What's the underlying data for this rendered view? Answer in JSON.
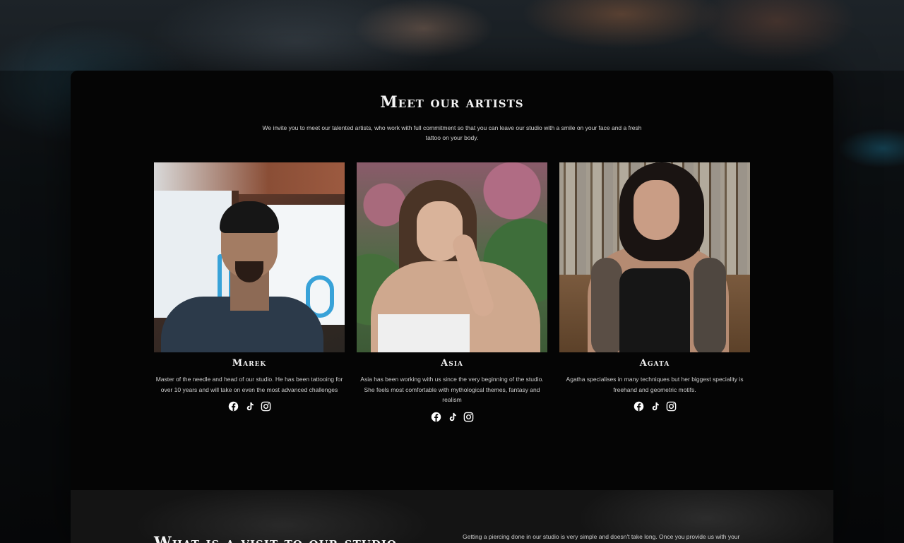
{
  "section": {
    "title": "Meet our artists",
    "intro": "We invite you to meet our talented artists, who work with full commitment so that you can leave our studio with a smile on your face and a fresh tattoo on your body."
  },
  "artists": [
    {
      "name": "Marek",
      "bio": "Master of the needle and head of our studio. He has been tattooing for over 10 years and will take on even the most advanced challenges",
      "socials": [
        "facebook-icon",
        "tiktok-icon",
        "instagram-icon"
      ]
    },
    {
      "name": "Asia",
      "bio": "Asia has been working with us since the very beginning of the studio. She feels most comfortable with mythological themes, fantasy and realism",
      "socials": [
        "facebook-icon",
        "tiktok-icon",
        "instagram-icon"
      ]
    },
    {
      "name": "Agata",
      "bio": "Agatha specialises in many techniques but her biggest speciality is freehand and geometric motifs.",
      "socials": [
        "facebook-icon",
        "tiktok-icon",
        "instagram-icon"
      ]
    }
  ],
  "visit_section": {
    "title": "What is a visit to our studio",
    "text": "Getting a piercing done in our studio is very simple and doesn't take long. Once you provide us with your"
  },
  "colors": {
    "card_bg": "#050505",
    "text": "#e8e8e8",
    "accent_blue": "#38a2d8"
  }
}
